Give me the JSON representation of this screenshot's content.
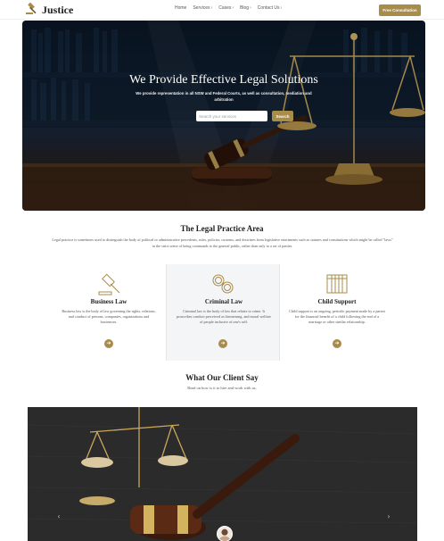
{
  "brand": {
    "name": "Justice",
    "icon": "gavel-icon",
    "accent": "#a88c4a"
  },
  "nav": {
    "items": [
      {
        "label": "Home",
        "dropdown": false
      },
      {
        "label": "Services",
        "dropdown": true
      },
      {
        "label": "Cases",
        "dropdown": true
      },
      {
        "label": "Blog",
        "dropdown": true
      },
      {
        "label": "Contact Us",
        "dropdown": true
      }
    ],
    "cta_label": "Free Consultation"
  },
  "hero": {
    "title": "We Provide Effective Legal Solutions",
    "subtitle": "We provide representation in all NSW and Federal Courts, as well as consultation, mediation and arbitration",
    "search_placeholder": "Search your services",
    "search_button": "Search"
  },
  "practice": {
    "title": "The Legal Practice Area",
    "description": "Legal practice is sometimes used to distinguish the body of political or administrative precedents, rules, policies, customs, and doctrines from legislative enactments such as statutes and constitutions which might be called \"laws\" in the strict sense of being commands to the general public, rather than only to a set of parties.",
    "cards": [
      {
        "icon": "gavel-icon",
        "title": "Business Law",
        "text": "Business law is the body of law governing the rights, relations, and conduct of persons, companies, organizations and businesses."
      },
      {
        "icon": "handcuffs-icon",
        "title": "Criminal Law",
        "text": "Criminal law is the body of law that relates to crime. It proscribes conduct perceived as threatening, and moral welfare of people inclusive of one's self."
      },
      {
        "icon": "jail-bars-icon",
        "title": "Child Support",
        "text": "Child support is an ongoing, periodic payment made by a parent for the financial benefit of a child following the end of a marriage or other similar relationship."
      }
    ]
  },
  "clients": {
    "title": "What Our Client Say",
    "subtitle": "Read on how is it to hire and work with us."
  }
}
